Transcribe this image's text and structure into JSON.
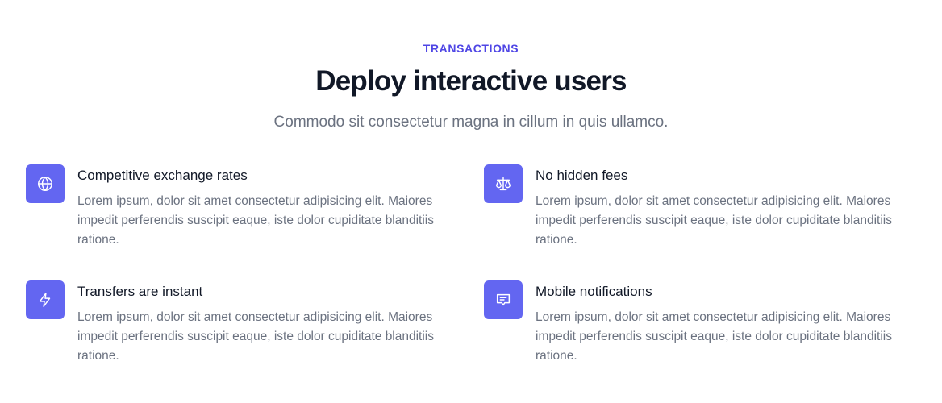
{
  "header": {
    "eyebrow": "TRANSACTIONS",
    "title": "Deploy interactive users",
    "subtitle": "Commodo sit consectetur magna in cillum in quis ullamco."
  },
  "colors": {
    "accent": "#4f46e5",
    "icon_bg": "#6366f1",
    "heading": "#111827",
    "muted": "#6b7280"
  },
  "features": [
    {
      "icon": "globe-icon",
      "title": "Competitive exchange rates",
      "description": "Lorem ipsum, dolor sit amet consectetur adipisicing elit. Maiores impedit perferendis suscipit eaque, iste dolor cupiditate blanditiis ratione."
    },
    {
      "icon": "scale-icon",
      "title": "No hidden fees",
      "description": "Lorem ipsum, dolor sit amet consectetur adipisicing elit. Maiores impedit perferendis suscipit eaque, iste dolor cupiditate blanditiis ratione."
    },
    {
      "icon": "lightning-bolt-icon",
      "title": "Transfers are instant",
      "description": "Lorem ipsum, dolor sit amet consectetur adipisicing elit. Maiores impedit perferendis suscipit eaque, iste dolor cupiditate blanditiis ratione."
    },
    {
      "icon": "chat-alt-icon",
      "title": "Mobile notifications",
      "description": "Lorem ipsum, dolor sit amet consectetur adipisicing elit. Maiores impedit perferendis suscipit eaque, iste dolor cupiditate blanditiis ratione."
    }
  ]
}
